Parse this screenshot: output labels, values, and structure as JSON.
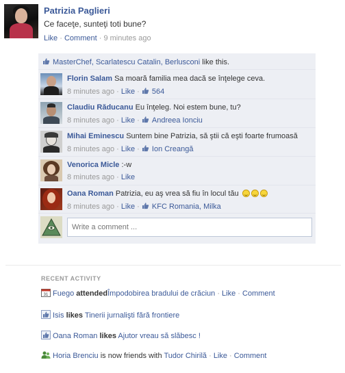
{
  "post": {
    "author": "Patrizia Paglieri",
    "text": "Ce faceţe, sunteţi toti bune?",
    "like": "Like",
    "comment": "Comment",
    "time": "9 minutes ago",
    "separator": "·"
  },
  "likes_bar": {
    "names": "MasterChef, Scarlatescu Catalin, Berlusconi",
    "suffix": " like this."
  },
  "comments": [
    {
      "name": "Florin Salam",
      "text": "Sa moară familia mea dacă se înţelege ceva.",
      "time": "8 minutes ago",
      "like": "Like",
      "likes": "564"
    },
    {
      "name": "Claudiu Răducanu",
      "text": "Eu înţeleg. Noi estem bune, tu?",
      "time": "8 minutes ago",
      "like": "Like",
      "likes": "Andreea Ionciu"
    },
    {
      "name": "Mihai Eminescu",
      "text": "Suntem bine Patrizia, să ştii că eşti foarte frumoasă",
      "time": "8 minutes ago",
      "like": "Like",
      "likes": "Ion Creangă"
    },
    {
      "name": "Venorica Micle",
      "text": ":-w",
      "time": "8 minutes ago",
      "like": "Like",
      "likes": ""
    },
    {
      "name": "Oana Roman",
      "text": "Patrizia, eu aş vrea să fiu în locul tău",
      "time": "8 minutes ago",
      "like": "Like",
      "likes": "KFC Romania, Milka"
    }
  ],
  "write_comment": {
    "placeholder": "Write a comment ..."
  },
  "recent": {
    "title": "RECENT ACTIVITY",
    "items": [
      {
        "icon": "calendar-icon",
        "actor": "Fuego",
        "verb": "attended",
        "object": "Împodobirea bradului de crăciun",
        "like": "Like",
        "comment": "Comment"
      },
      {
        "icon": "like-page-icon",
        "actor": "Isis",
        "verb": "likes",
        "object": "Tinerii jurnalişti fără frontiere"
      },
      {
        "icon": "like-page-icon",
        "actor": "Oana Roman",
        "verb": "likes",
        "object": "Ajutor vreau să slăbesc !"
      },
      {
        "icon": "friends-icon",
        "actor": "Horia Brenciu",
        "verb": "is now",
        "verb2": "friends",
        "verb3": "with",
        "object": "Tudor Chirilă",
        "like": "Like",
        "comment": "Comment"
      }
    ]
  },
  "colors": {
    "link": "#3b5998",
    "panel": "#edeff4",
    "meta": "#999999"
  }
}
